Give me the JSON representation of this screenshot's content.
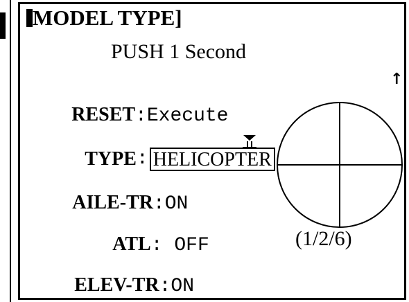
{
  "screen": {
    "title": "MODEL TYPE]",
    "title_open": "[",
    "hint": "PUSH 1 Second",
    "scroll_up_icon": "up-arrow-icon"
  },
  "settings": {
    "reset": {
      "label": "RESET",
      "separator": ":",
      "value": "Execute"
    },
    "type": {
      "label": "TYPE",
      "separator": ":",
      "value": "HELICOPTER",
      "icon": "select-list-icon"
    },
    "aile_tr": {
      "label": "AILE-TR",
      "separator": ":",
      "value": "ON"
    },
    "atl": {
      "label": "ATL",
      "separator": ":",
      "value": " OFF"
    },
    "elev_tr": {
      "label": "ELEV-TR",
      "separator": ":",
      "value": "ON"
    }
  },
  "stick": {
    "position_label": "(1/2/6)"
  },
  "colors": {
    "foreground": "#000000",
    "background": "#ffffff"
  }
}
